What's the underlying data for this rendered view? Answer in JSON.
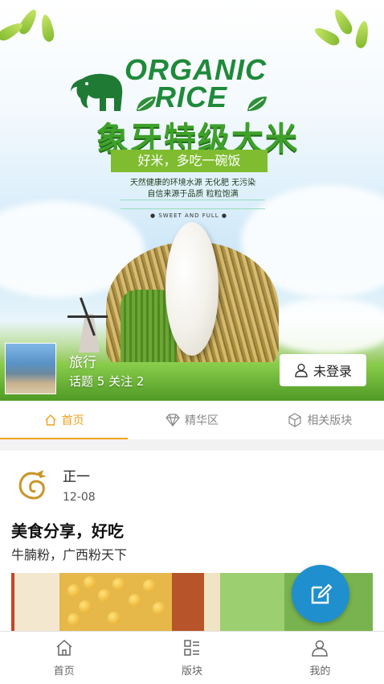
{
  "banner": {
    "brand_line1": "ORGANIC",
    "brand_line2": "RICE",
    "cn_title": "象牙特级大米",
    "slogan": "好米，多吃一碗饭",
    "desc_line1": "天然健康的环境水源 无化肥 无污染",
    "desc_line2": "自信来源于品质 粒粒饱满",
    "tagline": "● SWEET AND FULL ●"
  },
  "forum": {
    "name": "旅行",
    "stats": "话题 5 关注 2",
    "login_label": "未登录"
  },
  "tabs": [
    {
      "label": "首页",
      "icon": "home-icon",
      "active": true
    },
    {
      "label": "精华区",
      "icon": "diamond-icon",
      "active": false
    },
    {
      "label": "相关版块",
      "icon": "cube-icon",
      "active": false
    }
  ],
  "post": {
    "author": "正一",
    "date": "12-08",
    "title": "美食分享，好吃",
    "excerpt": "牛腩粉，广西粉天下"
  },
  "bottom_nav": [
    {
      "label": "首页",
      "icon": "home-icon"
    },
    {
      "label": "版块",
      "icon": "sections-icon"
    },
    {
      "label": "我的",
      "icon": "user-icon"
    }
  ],
  "colors": {
    "accent": "#f0a21e",
    "fab": "#1f8fce"
  }
}
